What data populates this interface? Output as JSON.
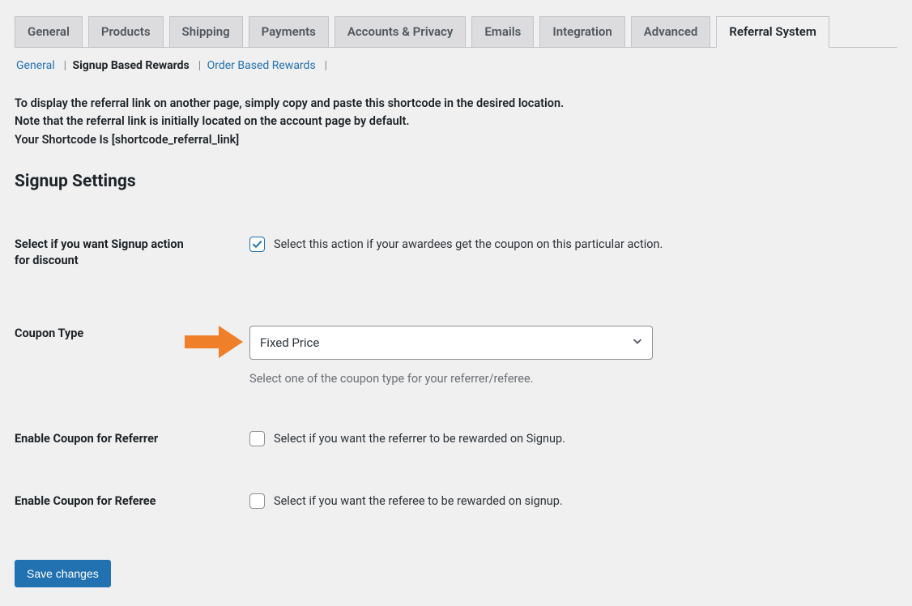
{
  "tabs": [
    {
      "label": "General"
    },
    {
      "label": "Products"
    },
    {
      "label": "Shipping"
    },
    {
      "label": "Payments"
    },
    {
      "label": "Accounts & Privacy"
    },
    {
      "label": "Emails"
    },
    {
      "label": "Integration"
    },
    {
      "label": "Advanced"
    },
    {
      "label": "Referral System",
      "active": true
    }
  ],
  "subnav": {
    "general": "General",
    "signup": "Signup Based Rewards",
    "order": "Order Based Rewards"
  },
  "desc": {
    "line1": "To display the referral link on another page, simply copy and paste this shortcode in the desired location.",
    "line2": "Note that the referral link is initially located on the account page by default.",
    "line3": "Your Shortcode Is [shortcode_referral_link]"
  },
  "section_title": "Signup Settings",
  "rows": {
    "action": {
      "label": "Select if you want Signup action for discount",
      "desc": "Select this action if your awardees get the coupon on this particular action.",
      "checked": true
    },
    "coupon_type": {
      "label": "Coupon Type",
      "value": "Fixed Price",
      "help": "Select one of the coupon type for your referrer/referee."
    },
    "referrer": {
      "label": "Enable Coupon for Referrer",
      "desc": "Select if you want the referrer to be rewarded on Signup.",
      "checked": false
    },
    "referee": {
      "label": "Enable Coupon for Referee",
      "desc": "Select if you want the referee to be rewarded on signup.",
      "checked": false
    }
  },
  "save_label": "Save changes"
}
